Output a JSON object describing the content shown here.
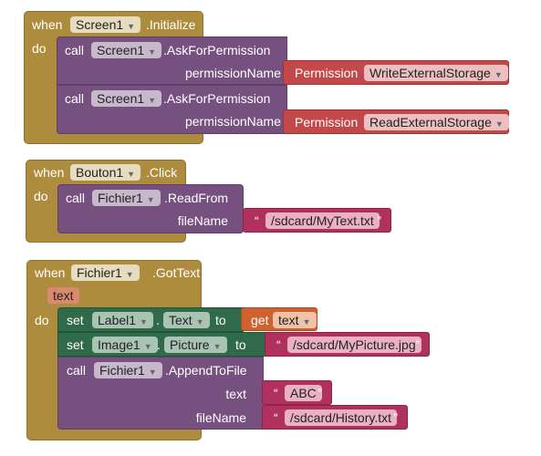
{
  "blocks": [
    {
      "event": {
        "when": "when",
        "component": "Screen1",
        "name": ".Initialize",
        "do": "do"
      },
      "calls": [
        {
          "call": "call",
          "component": "Screen1",
          "method": ".AskForPermission",
          "arg": "permissionName",
          "value_label": "Permission",
          "value": "WriteExternalStorage"
        },
        {
          "call": "call",
          "component": "Screen1",
          "method": ".AskForPermission",
          "arg": "permissionName",
          "value_label": "Permission",
          "value": "ReadExternalStorage"
        }
      ]
    },
    {
      "event": {
        "when": "when",
        "component": "Bouton1",
        "name": ".Click",
        "do": "do"
      },
      "call": {
        "call": "call",
        "component": "Fichier1",
        "method": ".ReadFrom",
        "arg": "fileName",
        "value": "/sdcard/MyText.txt"
      }
    },
    {
      "event": {
        "when": "when",
        "component": "Fichier1",
        "name": ".GotText",
        "param": "text",
        "do": "do"
      },
      "set1": {
        "set": "set",
        "component": "Label1",
        "dot": ".",
        "property": "Text",
        "to": "to",
        "get": "get",
        "var": "text"
      },
      "set2": {
        "set": "set",
        "component": "Image1",
        "dot": ".",
        "property": "Picture",
        "to": "to",
        "value": "/sdcard/MyPicture.jpg"
      },
      "call": {
        "call": "call",
        "component": "Fichier1",
        "method": ".AppendToFile",
        "arg1": "text",
        "value1": "ABC",
        "arg2": "fileName",
        "value2": "/sdcard/History.txt"
      }
    }
  ],
  "quote_open": "“",
  "quote_close": "”",
  "colors": {
    "event": "#ae8c3e",
    "procedure": "#76507f",
    "setter": "#2f6a4a",
    "text": "#b0305e",
    "permission": "#c2484a",
    "variable": "#d0622f"
  }
}
